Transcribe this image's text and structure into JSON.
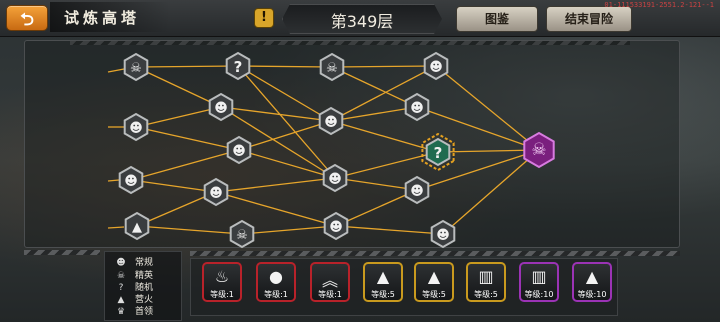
{
  "header": {
    "back_glyph": "⮌",
    "title": "试炼高塔",
    "warn_glyph": "!",
    "floor": "第349层",
    "atlas_label": "图鉴",
    "end_label": "结束冒险",
    "version": "01-111533191-2551.2-121--1"
  },
  "map": {
    "node_colors": {
      "normal": "#3a3d3f",
      "question": "#1f6b4f",
      "selected_border": "#e3a020",
      "boss": "#7a1f7e"
    },
    "nodes": [
      {
        "id": "n1",
        "kind": "elite",
        "glyph": "☠"
      },
      {
        "id": "n2",
        "kind": "normal",
        "glyph": "☻"
      },
      {
        "id": "n3",
        "kind": "normal",
        "glyph": "☻"
      },
      {
        "id": "n4",
        "kind": "camp",
        "glyph": "▲"
      },
      {
        "id": "n5",
        "kind": "random",
        "glyph": "?"
      },
      {
        "id": "n6",
        "kind": "normal",
        "glyph": "☻"
      },
      {
        "id": "n7",
        "kind": "normal",
        "glyph": "☻"
      },
      {
        "id": "n8",
        "kind": "normal",
        "glyph": "☻"
      },
      {
        "id": "n9",
        "kind": "elite",
        "glyph": "☠"
      },
      {
        "id": "n10",
        "kind": "elite",
        "glyph": "☠"
      },
      {
        "id": "n11",
        "kind": "normal",
        "glyph": "☻"
      },
      {
        "id": "n12",
        "kind": "normal",
        "glyph": "☻"
      },
      {
        "id": "n13",
        "kind": "normal",
        "glyph": "☻"
      },
      {
        "id": "n14",
        "kind": "normal",
        "glyph": "☻"
      },
      {
        "id": "n15",
        "kind": "normal",
        "glyph": "☻"
      },
      {
        "id": "n16",
        "kind": "random",
        "glyph": "?"
      },
      {
        "id": "n17",
        "kind": "normal",
        "glyph": "☻"
      },
      {
        "id": "n18",
        "kind": "normal",
        "glyph": "☻"
      },
      {
        "id": "boss",
        "kind": "boss",
        "glyph": "☠"
      }
    ]
  },
  "legend": [
    {
      "icon": "☻",
      "label": "常规"
    },
    {
      "icon": "☠",
      "label": "精英"
    },
    {
      "icon": "?",
      "label": "随机"
    },
    {
      "icon": "▲",
      "label": "营火"
    },
    {
      "icon": "♛",
      "label": "首领"
    }
  ],
  "skills": [
    {
      "glyph": "♨",
      "level": "等级:1",
      "border": "#b8222a"
    },
    {
      "glyph": "●",
      "level": "等级:1",
      "border": "#b8222a"
    },
    {
      "glyph": "︽",
      "level": "等级:1",
      "border": "#b8222a"
    },
    {
      "glyph": "▲",
      "level": "等级:5",
      "border": "#c99a1e"
    },
    {
      "glyph": "▲",
      "level": "等级:5",
      "border": "#c99a1e"
    },
    {
      "glyph": "▥",
      "level": "等级:5",
      "border": "#c99a1e"
    },
    {
      "glyph": "▥",
      "level": "等级:10",
      "border": "#9b33b5"
    },
    {
      "glyph": "▲",
      "level": "等级:10",
      "border": "#9b33b5"
    }
  ]
}
